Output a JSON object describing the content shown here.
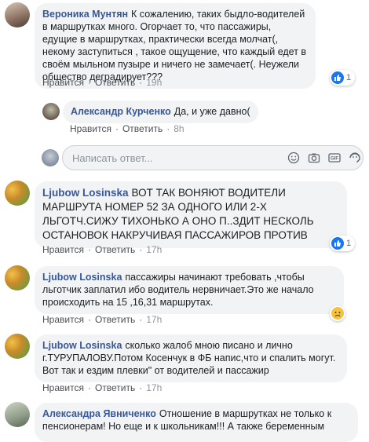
{
  "comments": [
    {
      "author": "Вероника Мунтян",
      "text": "К сожалению, таких быдло-водителей в маршрутках много. Огорчает то, что пассажиры, едущие в маршрутках, практически всегда молчат(, некому заступиться , такое ощущение, что каждый едет в своём мыльном пузыре и ничего не замечает(. Неужели общество деградирует???",
      "like": "Нравится",
      "reply": "Ответить",
      "time": "19h",
      "reaction": "like",
      "reaction_count": "1"
    },
    {
      "author": "Александр Курченко",
      "text": "Да, и уже давно(",
      "like": "Нравится",
      "reply": "Ответить",
      "time": "8h"
    },
    {
      "author": "Ljubow Losinska",
      "text": "ВОТ ТАК ВОНЯЮТ ВОДИТЕЛИ МАРШРУТА НОМЕР 52 ЗА ОДНОГО ИЛИ 2-Х ЛЬГОТЧ.СИЖУ ТИХОНЬКО А ОНО П..ЗДИТ НЕСКОЛЬ ОСТАНОВОК НАКРУЧИВАЯ ПАССАЖИРОВ ПРОТИВ",
      "like": "Нравится",
      "reply": "Ответить",
      "time": "17h",
      "reaction": "like",
      "reaction_count": "1"
    },
    {
      "author": "Ljubow Losinska",
      "text": "пассажиры начинают требовать ,чтобы льготчик заплатил ибо водитель нервничает.Это же начало происходить на 15 ,16,31 маршрутах.",
      "like": "Нравится",
      "reply": "Ответить",
      "time": "17h",
      "reaction": "sad"
    },
    {
      "author": "Ljubow Losinska",
      "text": "сколько жалоб мною писано и лично г.ТУРУПАЛОВУ.Потом Косенчук в ФБ напис,что и спалить могут. Вот так и ездим плевки\" от водителей и пассажир",
      "like": "Нравится",
      "reply": "Ответить",
      "time": "17h"
    },
    {
      "author": "Александра Явниченко",
      "text": "Отношение в маршрутках не только к пенсионерам! Но еще и к школьникам!!! А также беременным"
    }
  ],
  "reply_box": {
    "placeholder": "Написать ответ..."
  },
  "colors": {
    "link": "#385898",
    "like_blue": "#1877f2",
    "sad_yellow": "#f7c33d"
  }
}
